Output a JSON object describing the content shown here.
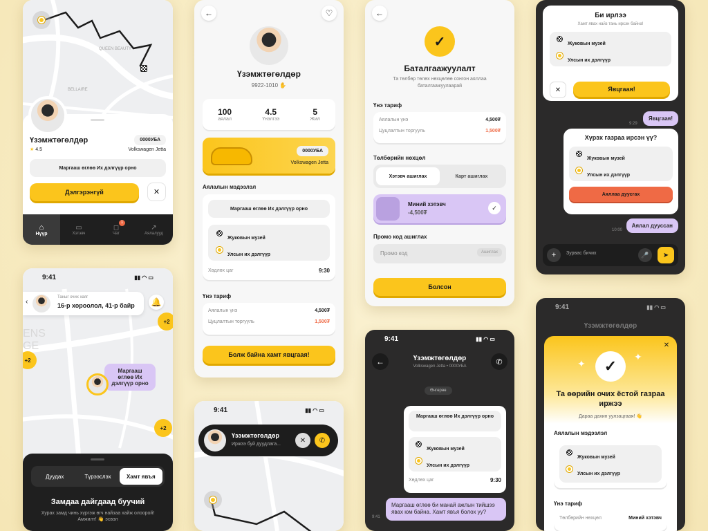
{
  "p1": {
    "driver": "Үзэмжтөгөлдөр",
    "rating": "4.5",
    "plate": "0000УБА",
    "car": "Volkswagen Jetta",
    "msg": "Маргааш өглөө Их дэлгүүр орно",
    "detail_btn": "Дэлгэрэнгүй",
    "nav": [
      {
        "label": "Нүүр"
      },
      {
        "label": "Хэтэвч"
      },
      {
        "label": "Чат",
        "badge": "1"
      },
      {
        "label": "Аялалууд"
      }
    ],
    "map_labels": [
      "QUEEN BEAUTY",
      "BELLAIRE"
    ]
  },
  "p2": {
    "driver": "Үзэмжтөгөлдөр",
    "phone": "9922-1010",
    "stats": [
      {
        "value": "100",
        "label": "аялал"
      },
      {
        "value": "4.5",
        "label": "Үнэлгээ"
      },
      {
        "value": "5",
        "label": "Жил"
      }
    ],
    "plate": "0000УБА",
    "car": "Volkswagen Jetta",
    "trip_title": "Аялалын мэдээлэл",
    "msg": "Маргааш өглөө Их дэлгүүр орно",
    "from": "Жуковын музей",
    "to": "Улсын их дэлгүүр",
    "depart_label": "Хөдлөх цаг",
    "depart": "9:30",
    "price_title": "Үнэ тариф",
    "fare_label": "Аялалын үнэ",
    "fare": "4,500₮",
    "disc_label": "Цуцлалтын торгууль",
    "disc": "1,500₮",
    "cta": "Болж байна хамт явцгаая!"
  },
  "p3": {
    "title": "Баталгаажуулалт",
    "subtitle": "Та төлбөр төлөх нөхцөлөө сонгон аяллаа баталгаажуулаарай",
    "price_title": "Үнэ тариф",
    "fare_label": "Аялалын үнэ",
    "fare": "4,500₮",
    "disc_label": "Цуцлалтын торгууль",
    "disc": "1,500₮",
    "pay_title": "Төлбөрийн нөхцөл",
    "tab1": "Хэтэвч ашиглах",
    "tab2": "Карт ашиглах",
    "wallet_label": "Миний хэтэвч",
    "wallet_val": "-4,500₮",
    "promo_title": "Промо код ашиглах",
    "promo_ph": "Промо код",
    "promo_btn": "Ашиглах",
    "done": "Болсон"
  },
  "p4": {
    "title": "Би ирлээ",
    "sub": "Хамт явах найз тань ирсэн байна!",
    "from": "Жуковын музей",
    "to": "Улсын их дэлгүүр",
    "go": "Явцгаая!",
    "bubble1": "Явцгаая!",
    "t1": "9:29",
    "q": "Хүрэх газраа ирсэн үү?",
    "end": "Аяллаа дуусгах",
    "t2": "10:00",
    "bubble2": "Аялал дууссан",
    "input_ph": "Зурвас бичих"
  },
  "p5": {
    "time": "9:41",
    "hint": "Таныг очих хаяг",
    "address": "16-р хороолол, 41-р байр",
    "badge": "+2",
    "bubble": "Маргааш өглөө Их дэлгүүр орно",
    "tabs": [
      "Дуудах",
      "Түрээслэх",
      "Хамт явъя"
    ],
    "heading": "Замдаа дайгдаад буучий",
    "desc": "Хурах замд чинь хүргэж өгч найзаа хайж олоорой! Амжилт! 👋 эсвэл",
    "map_label": "ENS GE"
  },
  "p6": {
    "time": "9:41",
    "driver": "Үзэмжтөгөлдөр",
    "sub": "Иржээ буй дуудлага..."
  },
  "p7": {
    "time": "9:41",
    "driver": "Үзэмжтөгөлдөр",
    "car": "Volkswagen Jetta • 0000УБА",
    "day": "Өнгөрөө",
    "msg": "Маргааш өглөө Их дэлгүүр орно",
    "from": "Жуковын музей",
    "to": "Улсын их дэлгүүр",
    "depart_label": "Хөдлөх цаг",
    "depart": "9:30",
    "bubble": "Маргааш өглөө би манай ажлын тийшээ явах юм байна. Хамт явъя болох уу?",
    "t": "9:41"
  },
  "p8": {
    "time": "9:41",
    "bg_title": "Үзэмжтөгөлдөр",
    "title": "Та өөрийн очих ёстой газраа иржээ",
    "sub": "Дараа дахин уулзацгаая! 👋",
    "trip_title": "Аялалын мэдээлэл",
    "from": "Жуковын музей",
    "to": "Улсын их дэлгүүр",
    "price_title": "Үнэ тариф",
    "cond_label": "Төлбөрийн нөхцөл",
    "cond": "Миний хэтэвч"
  }
}
